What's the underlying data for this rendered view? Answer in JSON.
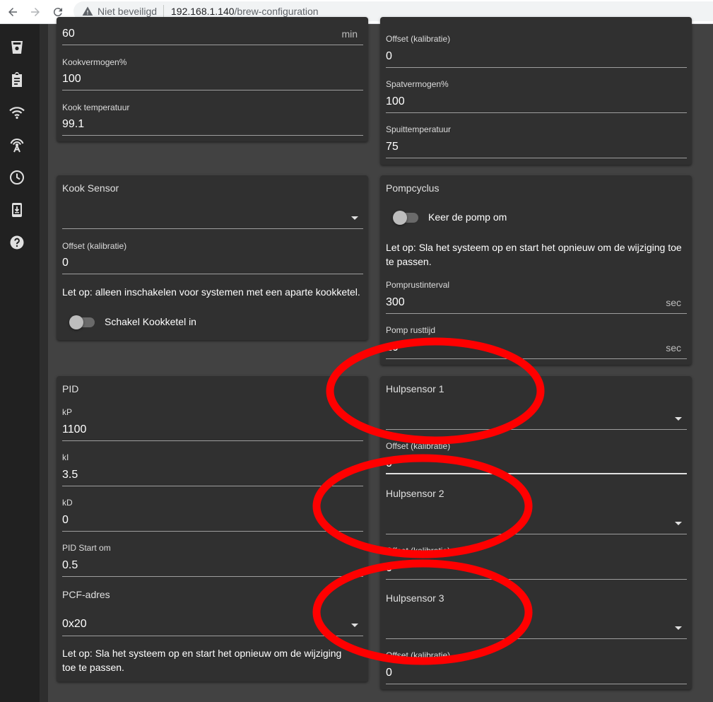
{
  "browser": {
    "security_label": "Niet beveiligd",
    "url_host": "192.168.1.140",
    "url_path": "/brew-configuration"
  },
  "sidebar": {
    "icons": [
      "brew-icon",
      "clipboard-icon",
      "wifi-icon",
      "access-point-icon",
      "clock-icon",
      "update-icon",
      "help-icon"
    ]
  },
  "boil_card": {
    "time_value": "60",
    "time_suffix": "min",
    "power_label": "Kookvermogen%",
    "power_value": "100",
    "temp_label": "Kook temperatuur",
    "temp_value": "99.1"
  },
  "sparge_card": {
    "offset_label": "Offset (kalibratie)",
    "offset_value": "0",
    "power_label": "Spatvermogen%",
    "power_value": "100",
    "temp_label": "Spuittemperatuur",
    "temp_value": "75"
  },
  "boil_sensor_card": {
    "title": "Kook Sensor",
    "sensor_value": "",
    "offset_label": "Offset (kalibratie)",
    "offset_value": "0",
    "note": "Let op: alleen inschakelen voor systemen met een aparte kookketel.",
    "toggle_label": "Schakel Kookketel in"
  },
  "pump_card": {
    "title": "Pompcyclus",
    "toggle_label": "Keer de pomp om",
    "note": "Let op: Sla het systeem op en start het opnieuw om de wijziging toe te passen.",
    "rest_interval_label": "Pomprustinterval",
    "rest_interval_value": "300",
    "rest_interval_suffix": "sec",
    "rest_time_label": "Pomp rusttijd",
    "rest_time_value": "10",
    "rest_time_suffix": "sec"
  },
  "pid_card": {
    "title": "PID",
    "kp_label": "kP",
    "kp_value": "1100",
    "ki_label": "kI",
    "ki_value": "3.5",
    "kd_label": "kD",
    "kd_value": "0",
    "start_label": "PID Start om",
    "start_value": "0.5",
    "pcf_title": "PCF-adres",
    "pcf_value": "0x20",
    "note": "Let op: Sla het systeem op en start het opnieuw om de wijziging toe te passen."
  },
  "aux_card": {
    "sensor1_title": "Hulpsensor 1",
    "sensor1_offset_label": "Offset (kalibratie)",
    "sensor1_offset_value": "0",
    "sensor2_title": "Hulpsensor 2",
    "sensor2_offset_label": "Offset (kalibratie)",
    "sensor2_offset_value": "0",
    "sensor3_title": "Hulpsensor 3",
    "sensor3_offset_label": "Offset (kalibratie)",
    "sensor3_offset_value": "0"
  },
  "colors": {
    "background": "#424242",
    "card": "#303030",
    "sidebar": "#212121",
    "annotation": "#ff0000"
  }
}
